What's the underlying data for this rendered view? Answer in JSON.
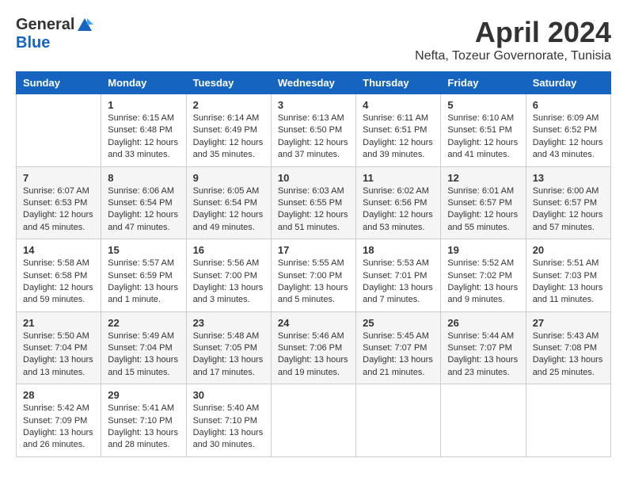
{
  "header": {
    "logo_general": "General",
    "logo_blue": "Blue",
    "month": "April 2024",
    "location": "Nefta, Tozeur Governorate, Tunisia"
  },
  "days_of_week": [
    "Sunday",
    "Monday",
    "Tuesday",
    "Wednesday",
    "Thursday",
    "Friday",
    "Saturday"
  ],
  "weeks": [
    [
      {
        "day": "",
        "info": ""
      },
      {
        "day": "1",
        "info": "Sunrise: 6:15 AM\nSunset: 6:48 PM\nDaylight: 12 hours\nand 33 minutes."
      },
      {
        "day": "2",
        "info": "Sunrise: 6:14 AM\nSunset: 6:49 PM\nDaylight: 12 hours\nand 35 minutes."
      },
      {
        "day": "3",
        "info": "Sunrise: 6:13 AM\nSunset: 6:50 PM\nDaylight: 12 hours\nand 37 minutes."
      },
      {
        "day": "4",
        "info": "Sunrise: 6:11 AM\nSunset: 6:51 PM\nDaylight: 12 hours\nand 39 minutes."
      },
      {
        "day": "5",
        "info": "Sunrise: 6:10 AM\nSunset: 6:51 PM\nDaylight: 12 hours\nand 41 minutes."
      },
      {
        "day": "6",
        "info": "Sunrise: 6:09 AM\nSunset: 6:52 PM\nDaylight: 12 hours\nand 43 minutes."
      }
    ],
    [
      {
        "day": "7",
        "info": "Sunrise: 6:07 AM\nSunset: 6:53 PM\nDaylight: 12 hours\nand 45 minutes."
      },
      {
        "day": "8",
        "info": "Sunrise: 6:06 AM\nSunset: 6:54 PM\nDaylight: 12 hours\nand 47 minutes."
      },
      {
        "day": "9",
        "info": "Sunrise: 6:05 AM\nSunset: 6:54 PM\nDaylight: 12 hours\nand 49 minutes."
      },
      {
        "day": "10",
        "info": "Sunrise: 6:03 AM\nSunset: 6:55 PM\nDaylight: 12 hours\nand 51 minutes."
      },
      {
        "day": "11",
        "info": "Sunrise: 6:02 AM\nSunset: 6:56 PM\nDaylight: 12 hours\nand 53 minutes."
      },
      {
        "day": "12",
        "info": "Sunrise: 6:01 AM\nSunset: 6:57 PM\nDaylight: 12 hours\nand 55 minutes."
      },
      {
        "day": "13",
        "info": "Sunrise: 6:00 AM\nSunset: 6:57 PM\nDaylight: 12 hours\nand 57 minutes."
      }
    ],
    [
      {
        "day": "14",
        "info": "Sunrise: 5:58 AM\nSunset: 6:58 PM\nDaylight: 12 hours\nand 59 minutes."
      },
      {
        "day": "15",
        "info": "Sunrise: 5:57 AM\nSunset: 6:59 PM\nDaylight: 13 hours\nand 1 minute."
      },
      {
        "day": "16",
        "info": "Sunrise: 5:56 AM\nSunset: 7:00 PM\nDaylight: 13 hours\nand 3 minutes."
      },
      {
        "day": "17",
        "info": "Sunrise: 5:55 AM\nSunset: 7:00 PM\nDaylight: 13 hours\nand 5 minutes."
      },
      {
        "day": "18",
        "info": "Sunrise: 5:53 AM\nSunset: 7:01 PM\nDaylight: 13 hours\nand 7 minutes."
      },
      {
        "day": "19",
        "info": "Sunrise: 5:52 AM\nSunset: 7:02 PM\nDaylight: 13 hours\nand 9 minutes."
      },
      {
        "day": "20",
        "info": "Sunrise: 5:51 AM\nSunset: 7:03 PM\nDaylight: 13 hours\nand 11 minutes."
      }
    ],
    [
      {
        "day": "21",
        "info": "Sunrise: 5:50 AM\nSunset: 7:04 PM\nDaylight: 13 hours\nand 13 minutes."
      },
      {
        "day": "22",
        "info": "Sunrise: 5:49 AM\nSunset: 7:04 PM\nDaylight: 13 hours\nand 15 minutes."
      },
      {
        "day": "23",
        "info": "Sunrise: 5:48 AM\nSunset: 7:05 PM\nDaylight: 13 hours\nand 17 minutes."
      },
      {
        "day": "24",
        "info": "Sunrise: 5:46 AM\nSunset: 7:06 PM\nDaylight: 13 hours\nand 19 minutes."
      },
      {
        "day": "25",
        "info": "Sunrise: 5:45 AM\nSunset: 7:07 PM\nDaylight: 13 hours\nand 21 minutes."
      },
      {
        "day": "26",
        "info": "Sunrise: 5:44 AM\nSunset: 7:07 PM\nDaylight: 13 hours\nand 23 minutes."
      },
      {
        "day": "27",
        "info": "Sunrise: 5:43 AM\nSunset: 7:08 PM\nDaylight: 13 hours\nand 25 minutes."
      }
    ],
    [
      {
        "day": "28",
        "info": "Sunrise: 5:42 AM\nSunset: 7:09 PM\nDaylight: 13 hours\nand 26 minutes."
      },
      {
        "day": "29",
        "info": "Sunrise: 5:41 AM\nSunset: 7:10 PM\nDaylight: 13 hours\nand 28 minutes."
      },
      {
        "day": "30",
        "info": "Sunrise: 5:40 AM\nSunset: 7:10 PM\nDaylight: 13 hours\nand 30 minutes."
      },
      {
        "day": "",
        "info": ""
      },
      {
        "day": "",
        "info": ""
      },
      {
        "day": "",
        "info": ""
      },
      {
        "day": "",
        "info": ""
      }
    ]
  ]
}
